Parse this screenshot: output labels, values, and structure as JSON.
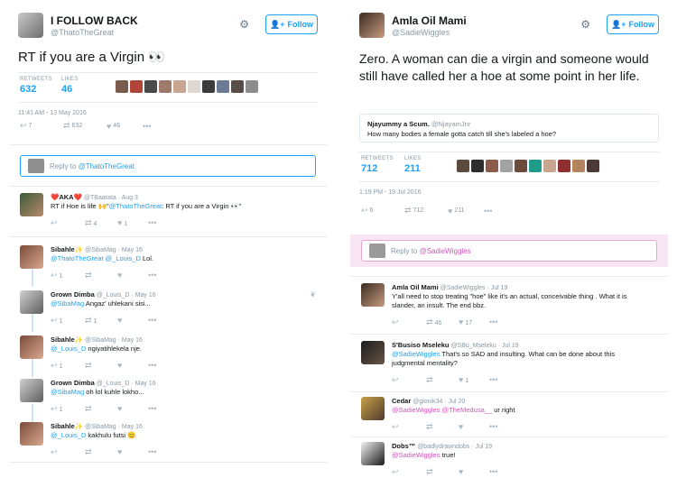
{
  "left": {
    "user": {
      "name": "I FOLLOW BACK",
      "handle": "@ThatoTheGreat"
    },
    "follow_label": "Follow",
    "tweet": "RT if you are a Virgin 👀",
    "stats": {
      "retweets_label": "RETWEETS",
      "retweets": "632",
      "likes_label": "LIKES",
      "likes": "46"
    },
    "date": "11:41 AM - 13 May 2016",
    "actions": {
      "replies": "7",
      "retweets": "632",
      "likes": "46"
    },
    "reply_box": {
      "prefix": "Reply to ",
      "mention": "@ThatoTheGreat"
    },
    "replies": [
      {
        "name": "❤️AKA❤️",
        "handle": "@TBaarata",
        "time": "· Aug 3",
        "text_a": "RT if Hoe is life 🙌\"",
        "mention": "@ThatoTheGreat",
        "text_b": ": RT if you are a Virgin 👀\"",
        "rt": "4",
        "like": "1"
      },
      {
        "name": "Sibahle✨",
        "handle": "@SibaMag",
        "time": "· May 16",
        "mention": "@ThatoTheGreat @_Louis_D",
        "text": " Lol.",
        "rt": "",
        "like": "",
        "reply": "1"
      },
      {
        "name": "Grown Dimba",
        "handle": "@_Louis_D",
        "time": "· May 16",
        "mention": "@SibaMag",
        "text": " Angaz' uhlekani sisi...",
        "reply": "1",
        "rt": "1",
        "like": ""
      },
      {
        "name": "Sibahle✨",
        "handle": "@SibaMag",
        "time": "· May 16",
        "mention": "@_Louis_D",
        "text": " ngiyatihlekela nje.",
        "reply": "1",
        "rt": "",
        "like": ""
      },
      {
        "name": "Grown Dimba",
        "handle": "@_Louis_D",
        "time": "· May 16",
        "mention": "@SibaMag",
        "text": " oh lol kuhle lokho...",
        "reply": "1",
        "rt": "",
        "like": ""
      },
      {
        "name": "Sibahle✨",
        "handle": "@SibaMag",
        "time": "· May 16",
        "mention": "@_Louis_D",
        "text": " kakhulu futsi 😊",
        "reply": "",
        "rt": "",
        "like": ""
      }
    ]
  },
  "right": {
    "user": {
      "name": "Amla Oil Mami",
      "handle": "@SadieWiggles"
    },
    "follow_label": "Follow",
    "tweet": "Zero. A woman can die a virgin and someone would still have called her a hoe at some point in her life.",
    "quote": {
      "name": "Njayummy a Scum.",
      "handle": "@NjayamJnr",
      "text": "How many bodies a female gotta catch till she's labeled a hoe?"
    },
    "stats": {
      "retweets_label": "RETWEETS",
      "retweets": "712",
      "likes_label": "LIKES",
      "likes": "211"
    },
    "date": "1:19 PM - 19 Jul 2016",
    "actions": {
      "replies": "6",
      "retweets": "712",
      "likes": "211"
    },
    "reply_box": {
      "prefix": "Reply to ",
      "mention": "@SadieWiggles"
    },
    "replies": [
      {
        "name": "Amla Oil Mami",
        "handle": "@SadieWiggles",
        "time": "· Jul 19",
        "text": "Y'all need to stop treating \"hoe\" like it's an actual, conceivable thing . What it is slander, an insult. The end bbz.",
        "rt": "46",
        "like": "17"
      },
      {
        "name": "S'Busiso Mseleku",
        "handle": "@SBu_Mseleku",
        "time": "· Jul 19",
        "mention": "@SadieWiggles",
        "text": " That's so SAD and insulting. What can be done about this judgmental mentality?",
        "rt": "",
        "like": "1"
      },
      {
        "name": "Cedar",
        "handle": "@glonik34",
        "time": "· Jul 20",
        "mention": "@SadieWiggles @TheMedusa__",
        "text": " ur right"
      },
      {
        "name": "Dobs™",
        "handle": "@badlydrawndobs",
        "time": "· Jul 19",
        "mention": "@SadieWiggles",
        "text": " true!"
      }
    ]
  },
  "colors": {
    "blue": "#1da1f2",
    "pink": "#d84fbf",
    "gray": "#8899a6"
  },
  "icons": [
    "reply-icon",
    "retweet-icon",
    "heart-icon",
    "more-icon",
    "gear-icon",
    "add-user-icon"
  ]
}
